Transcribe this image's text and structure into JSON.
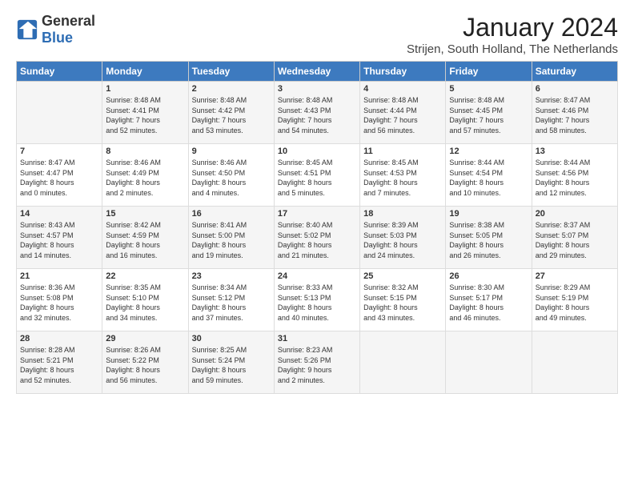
{
  "header": {
    "logo_general": "General",
    "logo_blue": "Blue",
    "month": "January 2024",
    "location": "Strijen, South Holland, The Netherlands"
  },
  "days_of_week": [
    "Sunday",
    "Monday",
    "Tuesday",
    "Wednesday",
    "Thursday",
    "Friday",
    "Saturday"
  ],
  "weeks": [
    [
      {
        "day": "",
        "content": ""
      },
      {
        "day": "1",
        "content": "Sunrise: 8:48 AM\nSunset: 4:41 PM\nDaylight: 7 hours\nand 52 minutes."
      },
      {
        "day": "2",
        "content": "Sunrise: 8:48 AM\nSunset: 4:42 PM\nDaylight: 7 hours\nand 53 minutes."
      },
      {
        "day": "3",
        "content": "Sunrise: 8:48 AM\nSunset: 4:43 PM\nDaylight: 7 hours\nand 54 minutes."
      },
      {
        "day": "4",
        "content": "Sunrise: 8:48 AM\nSunset: 4:44 PM\nDaylight: 7 hours\nand 56 minutes."
      },
      {
        "day": "5",
        "content": "Sunrise: 8:48 AM\nSunset: 4:45 PM\nDaylight: 7 hours\nand 57 minutes."
      },
      {
        "day": "6",
        "content": "Sunrise: 8:47 AM\nSunset: 4:46 PM\nDaylight: 7 hours\nand 58 minutes."
      }
    ],
    [
      {
        "day": "7",
        "content": "Sunrise: 8:47 AM\nSunset: 4:47 PM\nDaylight: 8 hours\nand 0 minutes."
      },
      {
        "day": "8",
        "content": "Sunrise: 8:46 AM\nSunset: 4:49 PM\nDaylight: 8 hours\nand 2 minutes."
      },
      {
        "day": "9",
        "content": "Sunrise: 8:46 AM\nSunset: 4:50 PM\nDaylight: 8 hours\nand 4 minutes."
      },
      {
        "day": "10",
        "content": "Sunrise: 8:45 AM\nSunset: 4:51 PM\nDaylight: 8 hours\nand 5 minutes."
      },
      {
        "day": "11",
        "content": "Sunrise: 8:45 AM\nSunset: 4:53 PM\nDaylight: 8 hours\nand 7 minutes."
      },
      {
        "day": "12",
        "content": "Sunrise: 8:44 AM\nSunset: 4:54 PM\nDaylight: 8 hours\nand 10 minutes."
      },
      {
        "day": "13",
        "content": "Sunrise: 8:44 AM\nSunset: 4:56 PM\nDaylight: 8 hours\nand 12 minutes."
      }
    ],
    [
      {
        "day": "14",
        "content": "Sunrise: 8:43 AM\nSunset: 4:57 PM\nDaylight: 8 hours\nand 14 minutes."
      },
      {
        "day": "15",
        "content": "Sunrise: 8:42 AM\nSunset: 4:59 PM\nDaylight: 8 hours\nand 16 minutes."
      },
      {
        "day": "16",
        "content": "Sunrise: 8:41 AM\nSunset: 5:00 PM\nDaylight: 8 hours\nand 19 minutes."
      },
      {
        "day": "17",
        "content": "Sunrise: 8:40 AM\nSunset: 5:02 PM\nDaylight: 8 hours\nand 21 minutes."
      },
      {
        "day": "18",
        "content": "Sunrise: 8:39 AM\nSunset: 5:03 PM\nDaylight: 8 hours\nand 24 minutes."
      },
      {
        "day": "19",
        "content": "Sunrise: 8:38 AM\nSunset: 5:05 PM\nDaylight: 8 hours\nand 26 minutes."
      },
      {
        "day": "20",
        "content": "Sunrise: 8:37 AM\nSunset: 5:07 PM\nDaylight: 8 hours\nand 29 minutes."
      }
    ],
    [
      {
        "day": "21",
        "content": "Sunrise: 8:36 AM\nSunset: 5:08 PM\nDaylight: 8 hours\nand 32 minutes."
      },
      {
        "day": "22",
        "content": "Sunrise: 8:35 AM\nSunset: 5:10 PM\nDaylight: 8 hours\nand 34 minutes."
      },
      {
        "day": "23",
        "content": "Sunrise: 8:34 AM\nSunset: 5:12 PM\nDaylight: 8 hours\nand 37 minutes."
      },
      {
        "day": "24",
        "content": "Sunrise: 8:33 AM\nSunset: 5:13 PM\nDaylight: 8 hours\nand 40 minutes."
      },
      {
        "day": "25",
        "content": "Sunrise: 8:32 AM\nSunset: 5:15 PM\nDaylight: 8 hours\nand 43 minutes."
      },
      {
        "day": "26",
        "content": "Sunrise: 8:30 AM\nSunset: 5:17 PM\nDaylight: 8 hours\nand 46 minutes."
      },
      {
        "day": "27",
        "content": "Sunrise: 8:29 AM\nSunset: 5:19 PM\nDaylight: 8 hours\nand 49 minutes."
      }
    ],
    [
      {
        "day": "28",
        "content": "Sunrise: 8:28 AM\nSunset: 5:21 PM\nDaylight: 8 hours\nand 52 minutes."
      },
      {
        "day": "29",
        "content": "Sunrise: 8:26 AM\nSunset: 5:22 PM\nDaylight: 8 hours\nand 56 minutes."
      },
      {
        "day": "30",
        "content": "Sunrise: 8:25 AM\nSunset: 5:24 PM\nDaylight: 8 hours\nand 59 minutes."
      },
      {
        "day": "31",
        "content": "Sunrise: 8:23 AM\nSunset: 5:26 PM\nDaylight: 9 hours\nand 2 minutes."
      },
      {
        "day": "",
        "content": ""
      },
      {
        "day": "",
        "content": ""
      },
      {
        "day": "",
        "content": ""
      }
    ]
  ]
}
